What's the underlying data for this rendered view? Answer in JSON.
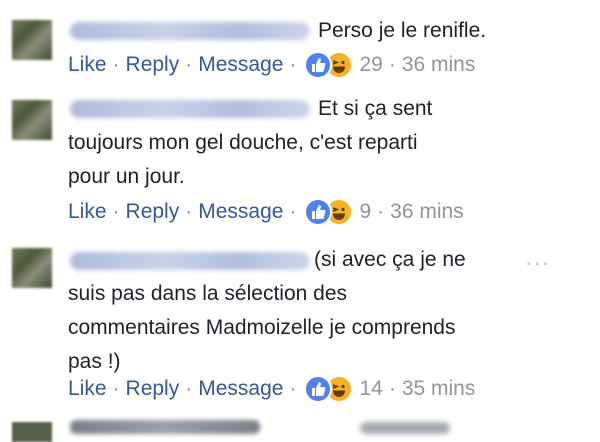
{
  "comments": [
    {
      "text": "Perso je le renifle.",
      "actions": {
        "like": "Like",
        "reply": "Reply",
        "message": "Message"
      },
      "reaction_count": "29",
      "timestamp": "36 mins",
      "reactions": [
        "like-icon",
        "haha-icon"
      ]
    },
    {
      "text_line1": "Et si ça sent",
      "text_rest": "toujours mon gel douche, c'est reparti\npour un jour.",
      "actions": {
        "like": "Like",
        "reply": "Reply",
        "message": "Message"
      },
      "reaction_count": "9",
      "timestamp": "36 mins",
      "reactions": [
        "like-icon",
        "haha-icon"
      ]
    },
    {
      "text_line1": "(si avec ça je ne",
      "text_rest": "suis pas dans la sélection des\ncommentaires Madmoizelle je comprends\npas !)",
      "actions": {
        "like": "Like",
        "reply": "Reply",
        "message": "Message"
      },
      "reaction_count": "14",
      "timestamp": "35 mins",
      "reactions": [
        "like-icon",
        "haha-icon"
      ]
    }
  ],
  "separator": "·",
  "more_options": "···",
  "colors": {
    "link": "#365899",
    "meta": "#90949c",
    "like": "#4f81f4",
    "haha": "#f7b125"
  }
}
